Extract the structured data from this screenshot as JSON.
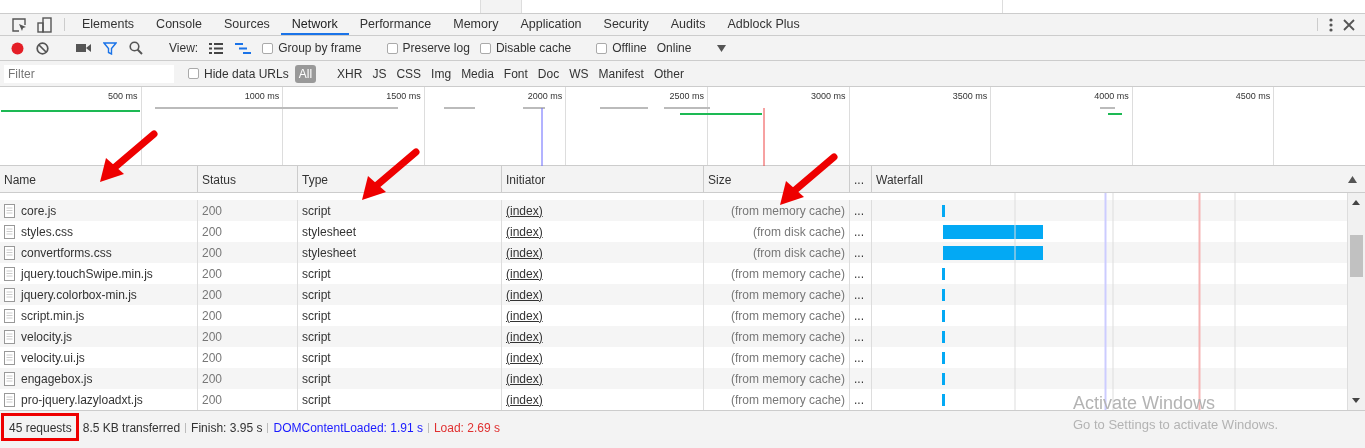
{
  "tabs": [
    {
      "label": "Elements",
      "selected": false
    },
    {
      "label": "Console",
      "selected": false
    },
    {
      "label": "Sources",
      "selected": false
    },
    {
      "label": "Network",
      "selected": true
    },
    {
      "label": "Performance",
      "selected": false
    },
    {
      "label": "Memory",
      "selected": false
    },
    {
      "label": "Application",
      "selected": false
    },
    {
      "label": "Security",
      "selected": false
    },
    {
      "label": "Audits",
      "selected": false
    },
    {
      "label": "Adblock Plus",
      "selected": false
    }
  ],
  "toolbar": {
    "recording": true,
    "filter_active": true,
    "view_label": "View:",
    "checkboxes": [
      {
        "label": "Group by frame",
        "checked": false
      },
      {
        "label": "Preserve log",
        "checked": false
      },
      {
        "label": "Disable cache",
        "checked": false
      },
      {
        "label": "Offline",
        "checked": false
      }
    ],
    "throttling": "Online"
  },
  "filter_bar": {
    "placeholder": "Filter",
    "hide_data_urls": {
      "label": "Hide data URLs",
      "checked": false
    },
    "types": [
      {
        "label": "All",
        "selected": true
      },
      {
        "label": "XHR",
        "selected": false
      },
      {
        "label": "JS",
        "selected": false
      },
      {
        "label": "CSS",
        "selected": false
      },
      {
        "label": "Img",
        "selected": false
      },
      {
        "label": "Media",
        "selected": false
      },
      {
        "label": "Font",
        "selected": false
      },
      {
        "label": "Doc",
        "selected": false
      },
      {
        "label": "WS",
        "selected": false
      },
      {
        "label": "Manifest",
        "selected": false
      },
      {
        "label": "Other",
        "selected": false
      }
    ]
  },
  "overview": {
    "ticks": [
      "500 ms",
      "1000 ms",
      "1500 ms",
      "2000 ms",
      "2500 ms",
      "3000 ms",
      "3500 ms",
      "4000 ms",
      "4500 ms"
    ]
  },
  "table": {
    "columns": [
      "Name",
      "Status",
      "Type",
      "Initiator",
      "Size",
      "...",
      "Waterfall"
    ],
    "rows": [
      {
        "name": "core.js",
        "status": "200",
        "type": "script",
        "initiator": "(index)",
        "size": "(from memory cache)",
        "more": "...",
        "waterfall": {
          "kind": "tick"
        }
      },
      {
        "name": "styles.css",
        "status": "200",
        "type": "stylesheet",
        "initiator": "(index)",
        "size": "(from disk cache)",
        "more": "...",
        "waterfall": {
          "kind": "long"
        }
      },
      {
        "name": "convertforms.css",
        "status": "200",
        "type": "stylesheet",
        "initiator": "(index)",
        "size": "(from disk cache)",
        "more": "...",
        "waterfall": {
          "kind": "long"
        }
      },
      {
        "name": "jquery.touchSwipe.min.js",
        "status": "200",
        "type": "script",
        "initiator": "(index)",
        "size": "(from memory cache)",
        "more": "...",
        "waterfall": {
          "kind": "tick"
        }
      },
      {
        "name": "jquery.colorbox-min.js",
        "status": "200",
        "type": "script",
        "initiator": "(index)",
        "size": "(from memory cache)",
        "more": "...",
        "waterfall": {
          "kind": "tick"
        }
      },
      {
        "name": "script.min.js",
        "status": "200",
        "type": "script",
        "initiator": "(index)",
        "size": "(from memory cache)",
        "more": "...",
        "waterfall": {
          "kind": "tick"
        }
      },
      {
        "name": "velocity.js",
        "status": "200",
        "type": "script",
        "initiator": "(index)",
        "size": "(from memory cache)",
        "more": "...",
        "waterfall": {
          "kind": "tick"
        }
      },
      {
        "name": "velocity.ui.js",
        "status": "200",
        "type": "script",
        "initiator": "(index)",
        "size": "(from memory cache)",
        "more": "...",
        "waterfall": {
          "kind": "tick"
        }
      },
      {
        "name": "engagebox.js",
        "status": "200",
        "type": "script",
        "initiator": "(index)",
        "size": "(from memory cache)",
        "more": "...",
        "waterfall": {
          "kind": "tick"
        }
      },
      {
        "name": "pro-jquery.lazyloadxt.js",
        "status": "200",
        "type": "script",
        "initiator": "(index)",
        "size": "(from memory cache)",
        "more": "...",
        "waterfall": {
          "kind": "tick"
        }
      }
    ]
  },
  "status_bar": [
    {
      "text": "45 requests",
      "kind": "plain"
    },
    {
      "text": "8.5 KB transferred",
      "kind": "plain"
    },
    {
      "text": "Finish: 3.95 s",
      "kind": "plain"
    },
    {
      "text": "DOMContentLoaded: 1.91 s",
      "kind": "dom"
    },
    {
      "text": "Load: 2.69 s",
      "kind": "load"
    }
  ],
  "os_notice": {
    "title": "Activate Windows",
    "message": "Go to Settings to activate Windows."
  }
}
